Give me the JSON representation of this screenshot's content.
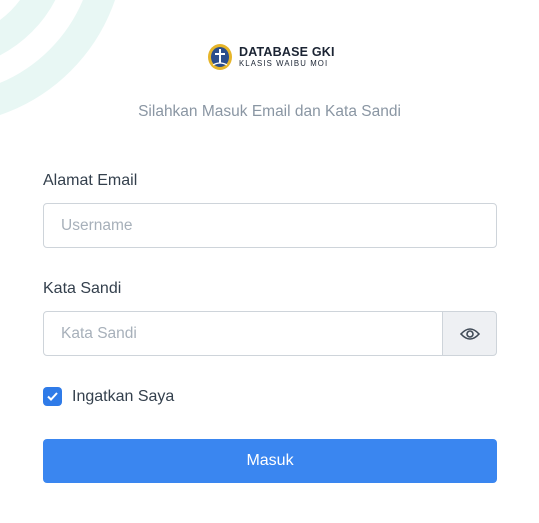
{
  "brand": {
    "title": "DATABASE GKI",
    "subtitle": "KLASIS WAIBU MOI"
  },
  "form": {
    "heading": "Silahkan Masuk Email dan Kata Sandi",
    "email_label": "Alamat Email",
    "email_placeholder": "Username",
    "email_value": "",
    "password_label": "Kata Sandi",
    "password_placeholder": "Kata Sandi",
    "password_value": "",
    "remember_label": "Ingatkan Saya",
    "remember_checked": true,
    "submit_label": "Masuk"
  },
  "colors": {
    "accent": "#3a86f0",
    "decoration": "#e6f6f3"
  }
}
